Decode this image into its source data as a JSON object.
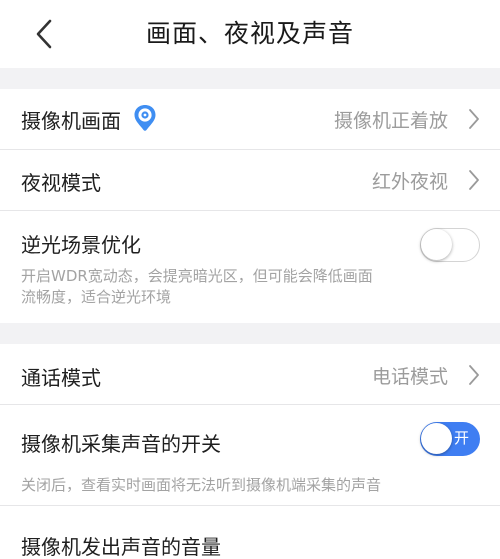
{
  "header": {
    "title": "画面、夜视及声音",
    "back_icon": "chevron-left-icon"
  },
  "section1": {
    "camera_view": {
      "label": "摄像机画面",
      "value": "摄像机正着放",
      "icon": "camera-pin-icon",
      "icon_color": "#3f8ef2"
    },
    "night_vision": {
      "label": "夜视模式",
      "value": "红外夜视"
    },
    "backlight": {
      "label": "逆光场景优化",
      "enabled": false,
      "desc_line1": "开启WDR宽动态，会提亮暗光区，但可能会降低画面",
      "desc_line2": "流畅度，适合逆光环境"
    }
  },
  "section2": {
    "call_mode": {
      "label": "通话模式",
      "value": "电话模式"
    },
    "mic_switch": {
      "label": "摄像机采集声音的开关",
      "enabled": true,
      "toggle_text": "开",
      "desc": "关闭后，查看实时画面将无法听到摄像机端采集的声音"
    },
    "volume": {
      "label": "摄像机发出声音的音量"
    }
  },
  "colors": {
    "accent": "#3f7ef2",
    "background": "#f2f2f4",
    "secondary_text": "#9c9c9c"
  }
}
